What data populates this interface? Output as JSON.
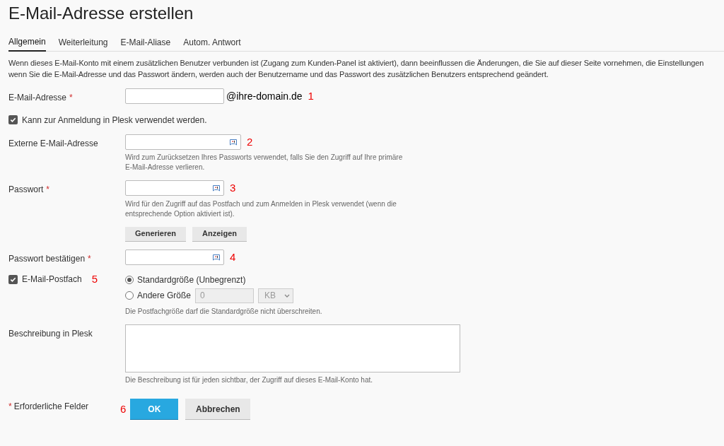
{
  "title": "E-Mail-Adresse erstellen",
  "tabs": [
    {
      "label": "Allgemein",
      "selected": true
    },
    {
      "label": "Weiterleitung",
      "selected": false
    },
    {
      "label": "E-Mail-Aliase",
      "selected": false
    },
    {
      "label": "Autom. Antwort",
      "selected": false
    }
  ],
  "intro": [
    "Wenn dieses E-Mail-Konto mit einem zusätzlichen Benutzer verbunden ist (Zugang zum Kunden-Panel ist aktiviert), dann beeinflussen die Änderungen, die Sie auf dieser Seite vornehmen, die Einstellungen",
    "wenn Sie die E-Mail-Adresse und das Passwort ändern, werden auch der Benutzername und das Passwort des zusätzlichen Benutzers entsprechend geändert."
  ],
  "email": {
    "label": "E-Mail-Adresse",
    "required_mark": "*",
    "suffix": "@ihre-domain.de",
    "marker": "1"
  },
  "login_checkbox": {
    "label": "Kann zur Anmeldung in Plesk verwendet werden.",
    "checked": true
  },
  "external_email": {
    "label": "Externe E-Mail-Adresse",
    "marker": "2",
    "hint": [
      "Wird zum Zurücksetzen Ihres Passworts verwendet, falls Sie den Zugriff auf Ihre primäre",
      "E-Mail-Adresse verlieren."
    ]
  },
  "password": {
    "label": "Passwort",
    "required_mark": "*",
    "marker": "3",
    "hint": [
      "Wird für den Zugriff auf das Postfach und zum Anmelden in Plesk verwendet (wenn die",
      "entsprechende Option aktiviert ist)."
    ],
    "buttons": [
      "Generieren",
      "Anzeigen"
    ]
  },
  "confirm_password": {
    "label": "Passwort bestätigen",
    "required_mark": "*",
    "marker": "4"
  },
  "mailbox": {
    "label": "E-Mail-Postfach",
    "checked": true,
    "marker": "5",
    "options": [
      {
        "label": "Standardgröße (Unbegrenzt)",
        "selected": true
      },
      {
        "label": "Andere Größe",
        "selected": false,
        "value": "0",
        "unit": "KB"
      }
    ],
    "hint": "Die Postfachgröße darf die Standardgröße nicht überschreiten."
  },
  "description": {
    "label": "Beschreibung in Plesk",
    "hint": "Die Beschreibung ist für jeden sichtbar, der Zugriff auf dieses E-Mail-Konto hat."
  },
  "footer": {
    "required_mark": "*",
    "required_note": "Erforderliche Felder",
    "marker": "6",
    "ok": "OK",
    "cancel": "Abbrechen"
  }
}
